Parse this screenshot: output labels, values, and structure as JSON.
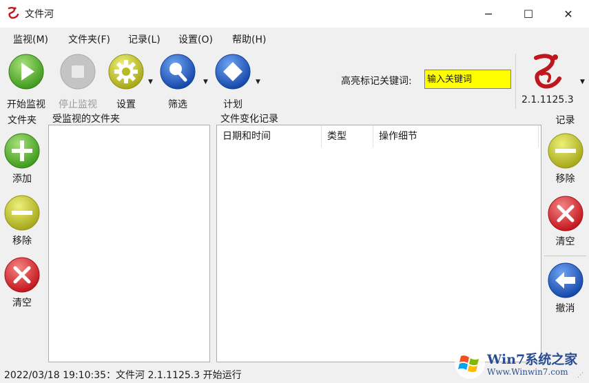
{
  "window": {
    "title": "文件河",
    "controls": {
      "minimize": "─",
      "maximize": "☐",
      "close": "✕"
    }
  },
  "menu": {
    "items": [
      "监视(M)",
      "文件夹(F)",
      "记录(L)",
      "设置(O)",
      "帮助(H)"
    ]
  },
  "toolbar": {
    "buttons": [
      {
        "label": "开始监视",
        "icon": "play-icon",
        "enabled": true
      },
      {
        "label": "停止监视",
        "icon": "stop-icon",
        "enabled": false
      },
      {
        "label": "设置",
        "icon": "gear-icon",
        "enabled": true,
        "dropdown": true
      },
      {
        "label": "筛选",
        "icon": "magnifier-icon",
        "enabled": true,
        "dropdown": true
      },
      {
        "label": "计划",
        "icon": "diamond-icon",
        "enabled": true,
        "dropdown": true
      }
    ],
    "keyword_label": "高亮标记关键词:",
    "keyword_value": "输入关键词",
    "version": "2.1.1125.3"
  },
  "left_panel": {
    "title": "文件夹",
    "buttons": [
      {
        "label": "添加",
        "icon": "plus-icon"
      },
      {
        "label": "移除",
        "icon": "minus-icon"
      },
      {
        "label": "清空",
        "icon": "x-icon"
      }
    ]
  },
  "folders_group": {
    "title": "受监视的文件夹"
  },
  "records_group": {
    "title": "文件变化记录",
    "columns": [
      "日期和时间",
      "类型",
      "操作细节"
    ]
  },
  "right_panel": {
    "title": "记录",
    "buttons": [
      {
        "label": "移除",
        "icon": "minus-icon"
      },
      {
        "label": "清空",
        "icon": "x-icon"
      },
      {
        "label": "撤消",
        "icon": "back-arrow-icon"
      }
    ]
  },
  "status": {
    "text": "2022/03/18 19:10:35：文件河 2.1.1125.3 开始运行"
  },
  "watermark": {
    "title": "Win7系统之家",
    "subtitle": "Www.Winwin7.com"
  },
  "colors": {
    "play": "#5cb82e",
    "stop": "#b9b9b9",
    "gear": "#c7c41b",
    "blue": "#1f5fc8",
    "green": "#5cb82e",
    "olive": "#b6b81e",
    "red": "#d8232a",
    "keyword_bg": "#ffff00"
  }
}
